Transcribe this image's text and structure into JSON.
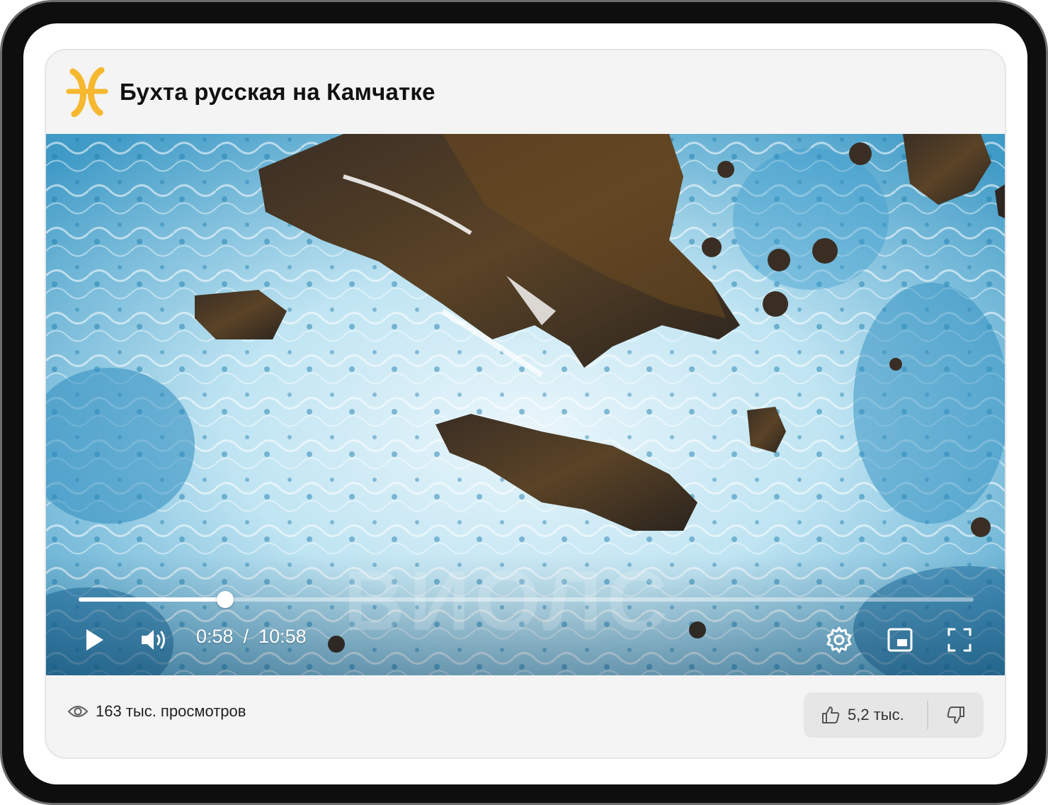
{
  "card": {
    "title": "Бухта русская на Камчатке",
    "logo_icon": "pisces-logo",
    "brand_color": "#F5B82E"
  },
  "player": {
    "watermark": "ВИОЛС",
    "progress_fraction": 0.164,
    "current_time": "0:58",
    "separator": "/",
    "duration": "10:58",
    "icons": {
      "play": "play-icon",
      "volume": "volume-icon",
      "settings": "gear-icon",
      "miniplayer": "miniplayer-icon",
      "fullscreen": "fullscreen-icon"
    }
  },
  "footer": {
    "views": "163 тыс. просмотров",
    "likes": "5,2 тыс.",
    "icons": {
      "views": "eye-icon",
      "like": "thumbs-up-icon",
      "dislike": "thumbs-down-icon"
    }
  }
}
